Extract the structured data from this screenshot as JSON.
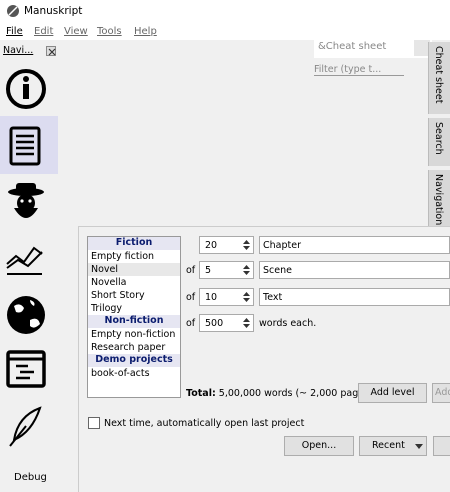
{
  "window": {
    "title": "Manuskript"
  },
  "menubar": {
    "file": "File",
    "edit": "Edit",
    "view": "View",
    "tools": "Tools",
    "help": "Help"
  },
  "navigation": {
    "title": "Navi...",
    "items": [
      "info-icon",
      "outline-icon",
      "character-icon",
      "plot-icon",
      "world-icon",
      "editor-icon",
      "quill-icon"
    ],
    "debug_label": "Debug"
  },
  "right_panel": {
    "cheat_placeholder": "&Cheat sheet",
    "filter_placeholder": "Filter (type t...",
    "tabs": [
      "Cheat sheet",
      "Search",
      "Navigation"
    ]
  },
  "welcome": {
    "templates": [
      {
        "type": "header",
        "label": "Fiction"
      },
      {
        "type": "item",
        "label": "Empty fiction"
      },
      {
        "type": "item",
        "label": "Novel",
        "selected": true
      },
      {
        "type": "item",
        "label": "Novella"
      },
      {
        "type": "item",
        "label": "Short Story"
      },
      {
        "type": "item",
        "label": "Trilogy"
      },
      {
        "type": "header",
        "label": "Non-fiction"
      },
      {
        "type": "item",
        "label": "Empty non-fiction"
      },
      {
        "type": "item",
        "label": "Research paper"
      },
      {
        "type": "header",
        "label": "Demo projects"
      },
      {
        "type": "item",
        "label": "book-of-acts"
      }
    ],
    "levels": [
      {
        "prefix": "",
        "value": "20",
        "name": "Chapter"
      },
      {
        "prefix": "of",
        "value": "5",
        "name": "Scene"
      },
      {
        "prefix": "of",
        "value": "10",
        "name": "Text"
      },
      {
        "prefix": "of",
        "value": "500",
        "name": ""
      }
    ],
    "words_each": "words each.",
    "total_label": "Total:",
    "total_value": "5,00,000 words (~ 2,000 pages)",
    "add_level": "Add level",
    "add_more": "Add",
    "autoopen_label": "Next time, automatically open last project",
    "open_button": "Open...",
    "recent_button": "Recent"
  }
}
